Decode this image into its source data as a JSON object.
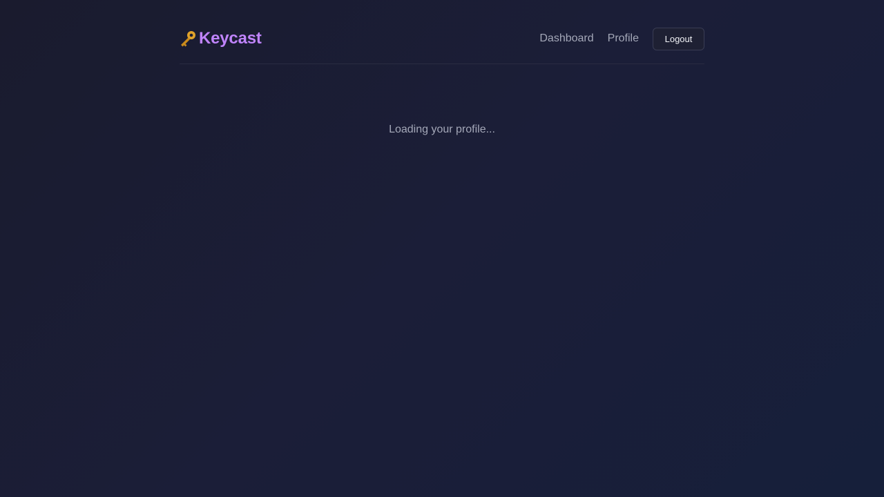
{
  "header": {
    "brand_name": "Keycast",
    "brand_icon": "key-icon",
    "nav": {
      "dashboard_label": "Dashboard",
      "profile_label": "Profile"
    },
    "logout_label": "Logout"
  },
  "main": {
    "loading_text": "Loading your profile..."
  },
  "colors": {
    "brand_accent": "#c084fc",
    "background": "#1b1d33",
    "muted_text": "#a4a8b8"
  }
}
